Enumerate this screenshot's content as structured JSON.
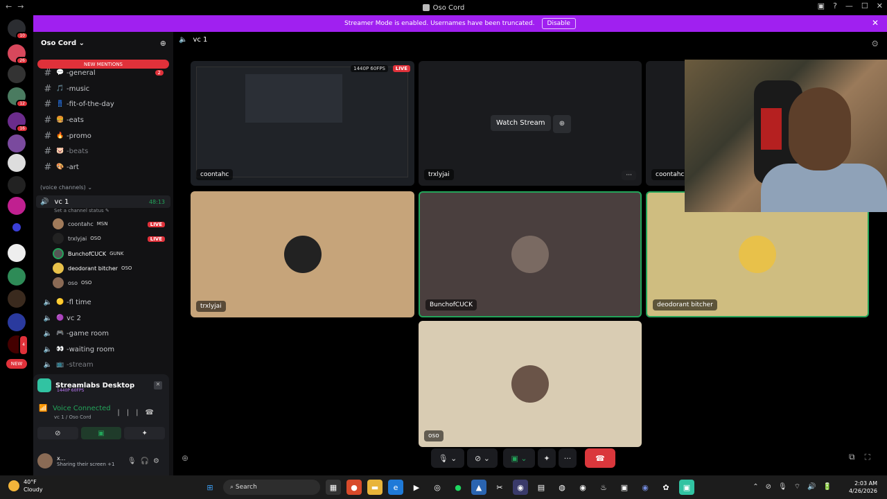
{
  "window": {
    "title": "Oso Cord"
  },
  "banner": {
    "text": "Streamer Mode is enabled. Usernames have been truncated.",
    "button": "Disable"
  },
  "servers": {
    "badges": [
      "10",
      "26",
      "12",
      "16",
      "4"
    ],
    "new_label": "NEW"
  },
  "guild": {
    "name": "Oso Cord",
    "new_mentions": "NEW MENTIONS"
  },
  "channels": [
    {
      "icon": "💬",
      "name": "-general",
      "count": "2"
    },
    {
      "icon": "🎵",
      "name": "-music",
      "count": ""
    },
    {
      "icon": "👖",
      "name": "-fit-of-the-day",
      "count": ""
    },
    {
      "icon": "🍔",
      "name": "-eats",
      "count": ""
    },
    {
      "icon": "🔥",
      "name": "-promo",
      "count": ""
    },
    {
      "icon": "🐷",
      "name": "-beats",
      "count": ""
    },
    {
      "icon": "🎨",
      "name": "-art",
      "count": ""
    }
  ],
  "voice_category": "(voice channels)",
  "active_voice": {
    "name": "vc 1",
    "time": "48:13",
    "status": "Set a channel status"
  },
  "members": [
    {
      "name": "coontahc",
      "tag": "MSN",
      "live": "LIVE"
    },
    {
      "name": "trxlyjai",
      "tag": "OSO",
      "live": "LIVE"
    },
    {
      "name": "BunchofCUCK",
      "tag": "GUNK",
      "live": ""
    },
    {
      "name": "deodorant bitcher",
      "tag": "OSO",
      "live": ""
    },
    {
      "name": "oso",
      "tag": "OSO",
      "live": ""
    }
  ],
  "voice_channels": [
    {
      "name": "-fl time"
    },
    {
      "name": "vc 2"
    },
    {
      "name": "-game room"
    },
    {
      "name": "-waiting room"
    },
    {
      "name": "-stream"
    }
  ],
  "panel": {
    "app": "Streamlabs Desktop",
    "app_sub": "1440P 60FPS",
    "voice_connected": "Voice Connected",
    "voice_sub": "vc 1 / Oso Cord",
    "user_name": "x...",
    "user_status": "Sharing their screen +1"
  },
  "header": {
    "channel": "vc 1"
  },
  "tiles": {
    "stream1": {
      "name": "coontahc",
      "fps": "1440P 60FPS",
      "live": "LIVE"
    },
    "stream2": {
      "name": "trxlyjai",
      "watch": "Watch Stream",
      "more": "···"
    },
    "stream3": {
      "name": "coontahc"
    },
    "cam1": {
      "name": "trxlyjai"
    },
    "cam2": {
      "name": "BunchofCUCK"
    },
    "cam3": {
      "name": "deodorant bitcher"
    },
    "cam4": {
      "name": "oso"
    }
  },
  "taskbar": {
    "temp": "40°F",
    "weather": "Cloudy",
    "search": "Search",
    "time": "2:03 AM",
    "date": "4/26/2026"
  },
  "colors": {
    "accent": "#a020f0",
    "live": "#e0313a",
    "connected": "#23a55a",
    "hangup": "#da373c"
  }
}
